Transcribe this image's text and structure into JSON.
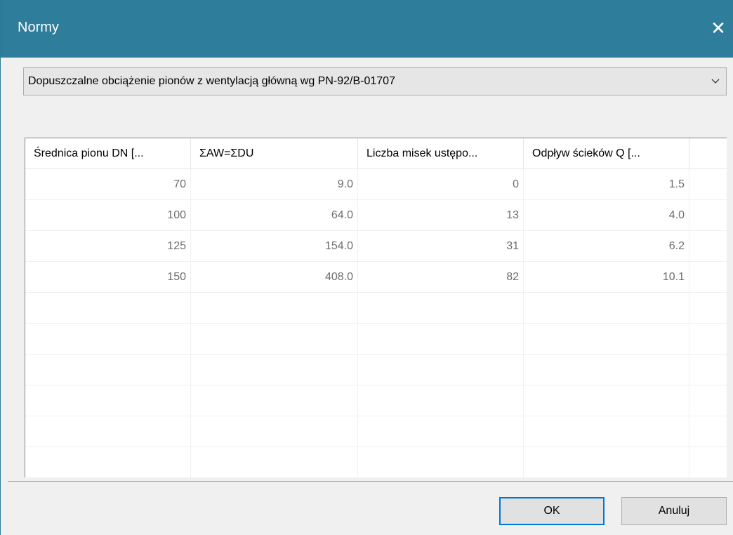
{
  "window": {
    "title": "Normy",
    "close_glyph": "✕"
  },
  "norm_select": {
    "value": "Dopuszczalne obciążenie pionów z wentylacją główną wg PN-92/B-01707"
  },
  "table": {
    "columns": [
      "Średnica pionu DN [...",
      "ΣAW=ΣDU",
      "Liczba misek ustępo...",
      "Odpływ ścieków Q [..."
    ],
    "rows": [
      [
        "70",
        "9.0",
        "0",
        "1.5"
      ],
      [
        "100",
        "64.0",
        "13",
        "4.0"
      ],
      [
        "125",
        "154.0",
        "31",
        "6.2"
      ],
      [
        "150",
        "408.0",
        "82",
        "10.1"
      ]
    ],
    "empty_rows": 6
  },
  "buttons": {
    "ok": "OK",
    "cancel": "Anuluj"
  },
  "colors": {
    "titlebar": "#2e7d9b",
    "focus_border": "#0078d7"
  }
}
